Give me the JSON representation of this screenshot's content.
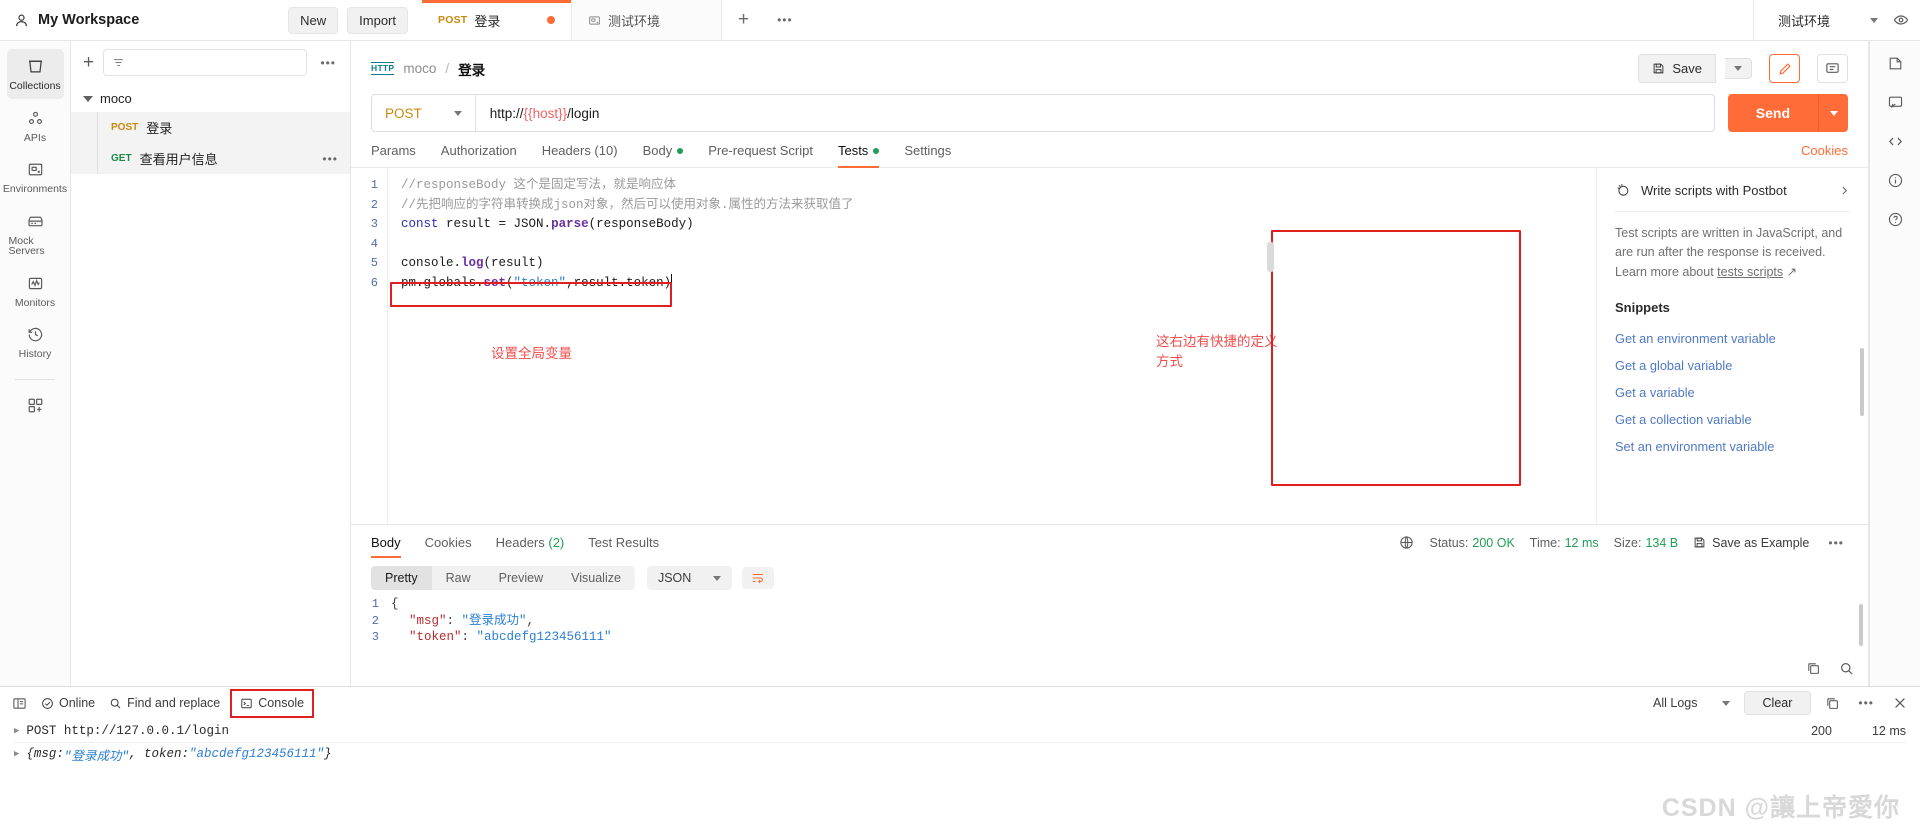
{
  "workspace": {
    "name": "My Workspace",
    "new_label": "New",
    "import_label": "Import"
  },
  "tabs": [
    {
      "method": "POST",
      "title": "登录",
      "unsaved": true
    },
    {
      "title": "测试环境",
      "icon": "environment-icon"
    }
  ],
  "environment": {
    "selected": "测试环境"
  },
  "rail": [
    {
      "label": "Collections",
      "icon": "collections-icon",
      "selected": true
    },
    {
      "label": "APIs",
      "icon": "apis-icon",
      "selected": false
    },
    {
      "label": "Environments",
      "icon": "environments-icon",
      "selected": false
    },
    {
      "label": "Mock Servers",
      "icon": "mock-servers-icon",
      "selected": false
    },
    {
      "label": "Monitors",
      "icon": "monitors-icon",
      "selected": false
    },
    {
      "label": "History",
      "icon": "history-icon",
      "selected": false
    }
  ],
  "sidebar": {
    "filter_placeholder": "",
    "collection": "moco",
    "requests": [
      {
        "method": "POST",
        "name": "登录",
        "selected": true
      },
      {
        "method": "GET",
        "name": "查看用户信息",
        "selected": true
      }
    ]
  },
  "request": {
    "breadcrumb_protocol": "HTTP",
    "breadcrumb_collection": "moco",
    "breadcrumb_name": "登录",
    "save_label": "Save",
    "method": "POST",
    "url_prefix": "http://",
    "url_var": "{{host}}",
    "url_suffix": "/login",
    "send_label": "Send",
    "cookies_label": "Cookies",
    "tabs": [
      {
        "label": "Params",
        "active": false,
        "dot": false
      },
      {
        "label": "Authorization",
        "active": false,
        "dot": false
      },
      {
        "label": "Headers (10)",
        "active": false,
        "dot": false
      },
      {
        "label": "Body",
        "active": false,
        "dot": true
      },
      {
        "label": "Pre-request Script",
        "active": false,
        "dot": false
      },
      {
        "label": "Tests",
        "active": true,
        "dot": true
      },
      {
        "label": "Settings",
        "active": false,
        "dot": false
      }
    ]
  },
  "editor": {
    "lines": [
      {
        "n": "1",
        "comment": "//responseBody 这个是固定写法，就是响应体"
      },
      {
        "n": "2",
        "comment": "//先把响应的字符串转换成json对象，然后可以使用对象.属性的方法来获取值了"
      },
      {
        "n": "3",
        "code": "const result = JSON.parse(responseBody)"
      },
      {
        "n": "4",
        "code": ""
      },
      {
        "n": "5",
        "code": "console.log(result)"
      },
      {
        "n": "6",
        "code": "pm.globals.set(\"token\",result.token)"
      }
    ]
  },
  "annotations": {
    "left": "设置全局变量",
    "right": "这右边有快捷的定义\n方式"
  },
  "helper": {
    "postbot_label": "Write scripts with Postbot",
    "description_line1": "Test scripts are written in JavaScript, and",
    "description_line2": "are run after the response is received.",
    "description_line3_pre": "Learn more about ",
    "description_link": "tests scripts",
    "snippets_title": "Snippets",
    "snippets": [
      "Get an environment variable",
      "Get a global variable",
      "Get a variable",
      "Get a collection variable",
      "Set an environment variable"
    ]
  },
  "response": {
    "tabs": [
      {
        "label": "Body",
        "active": true
      },
      {
        "label": "Cookies",
        "active": false
      },
      {
        "label": "Headers",
        "count": "(2)",
        "active": false
      },
      {
        "label": "Test Results",
        "active": false
      }
    ],
    "status_label": "Status:",
    "status_value": "200 OK",
    "time_label": "Time:",
    "time_value": "12 ms",
    "size_label": "Size:",
    "size_value": "134 B",
    "save_example": "Save as Example",
    "formats": [
      "Pretty",
      "Raw",
      "Preview",
      "Visualize"
    ],
    "active_format": "Pretty",
    "language": "JSON",
    "json_lines": [
      {
        "n": "1",
        "text": "{"
      },
      {
        "n": "2",
        "key": "\"msg\"",
        "value": "\"登录成功\"",
        "tail": ","
      },
      {
        "n": "3",
        "key": "\"token\"",
        "value": "\"abcdefg123456111\"",
        "tail": ""
      }
    ]
  },
  "console": {
    "online_label": "Online",
    "find_replace_label": "Find and replace",
    "console_label": "Console",
    "all_logs_label": "All Logs",
    "clear_label": "Clear",
    "entries": [
      {
        "text": "POST http://127.0.0.1/login",
        "status": "200",
        "time": "12 ms"
      }
    ],
    "response_log": {
      "prefix": "{msg: ",
      "msg_value": "\"登录成功\"",
      "mid": ", token: ",
      "token_value": "\"abcdefg123456111\"",
      "suffix": "}"
    }
  },
  "watermark": "CSDN @讓上帝愛你"
}
